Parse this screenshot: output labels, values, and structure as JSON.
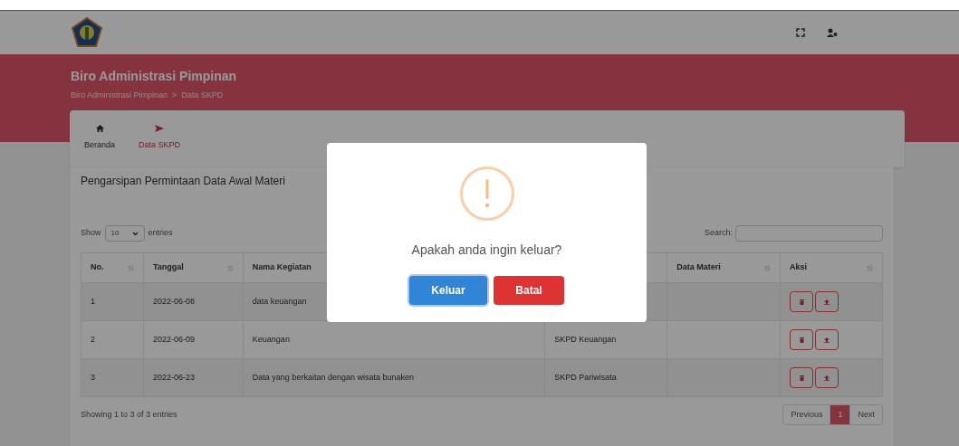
{
  "header": {
    "title": "Biro Administrasi Pimpinan",
    "breadcrumb": [
      "Biro Administrasi Pimpinan",
      "Data SKPD"
    ],
    "separator": ">"
  },
  "nav": [
    {
      "label": "Beranda",
      "kind": "home",
      "selected": false
    },
    {
      "label": "Data SKPD",
      "kind": "send",
      "selected": true
    }
  ],
  "section_title": "Pengarsipan Permintaan Data Awal Materi",
  "length": {
    "before": "Show",
    "value": "10",
    "after": "entries"
  },
  "search": {
    "label": "Search:"
  },
  "table": {
    "columns": [
      "No.",
      "Tanggal",
      "Nama Kegiatan",
      null,
      "Data Materi",
      "Aksi"
    ],
    "rows": [
      [
        "1",
        "2022-06-08",
        "data keuangan",
        null,
        ""
      ],
      [
        "2",
        "2022-06-09",
        "Keuangan",
        "SKPD Keuangan",
        ""
      ],
      [
        "3",
        "2022-06-23",
        "Data yang berkaitan dengan wisata bunaken",
        "SKPD Pariwisata",
        ""
      ]
    ]
  },
  "info": "Showing 1 to 3 of 3 entries",
  "pagination": [
    {
      "label": "Previous",
      "selected": false
    },
    {
      "label": "1",
      "selected": true
    },
    {
      "label": "Next",
      "selected": false
    }
  ],
  "dialog": {
    "message": "Apakah anda ingin keluar?",
    "confirm": "Keluar",
    "cancel": "Batal"
  }
}
